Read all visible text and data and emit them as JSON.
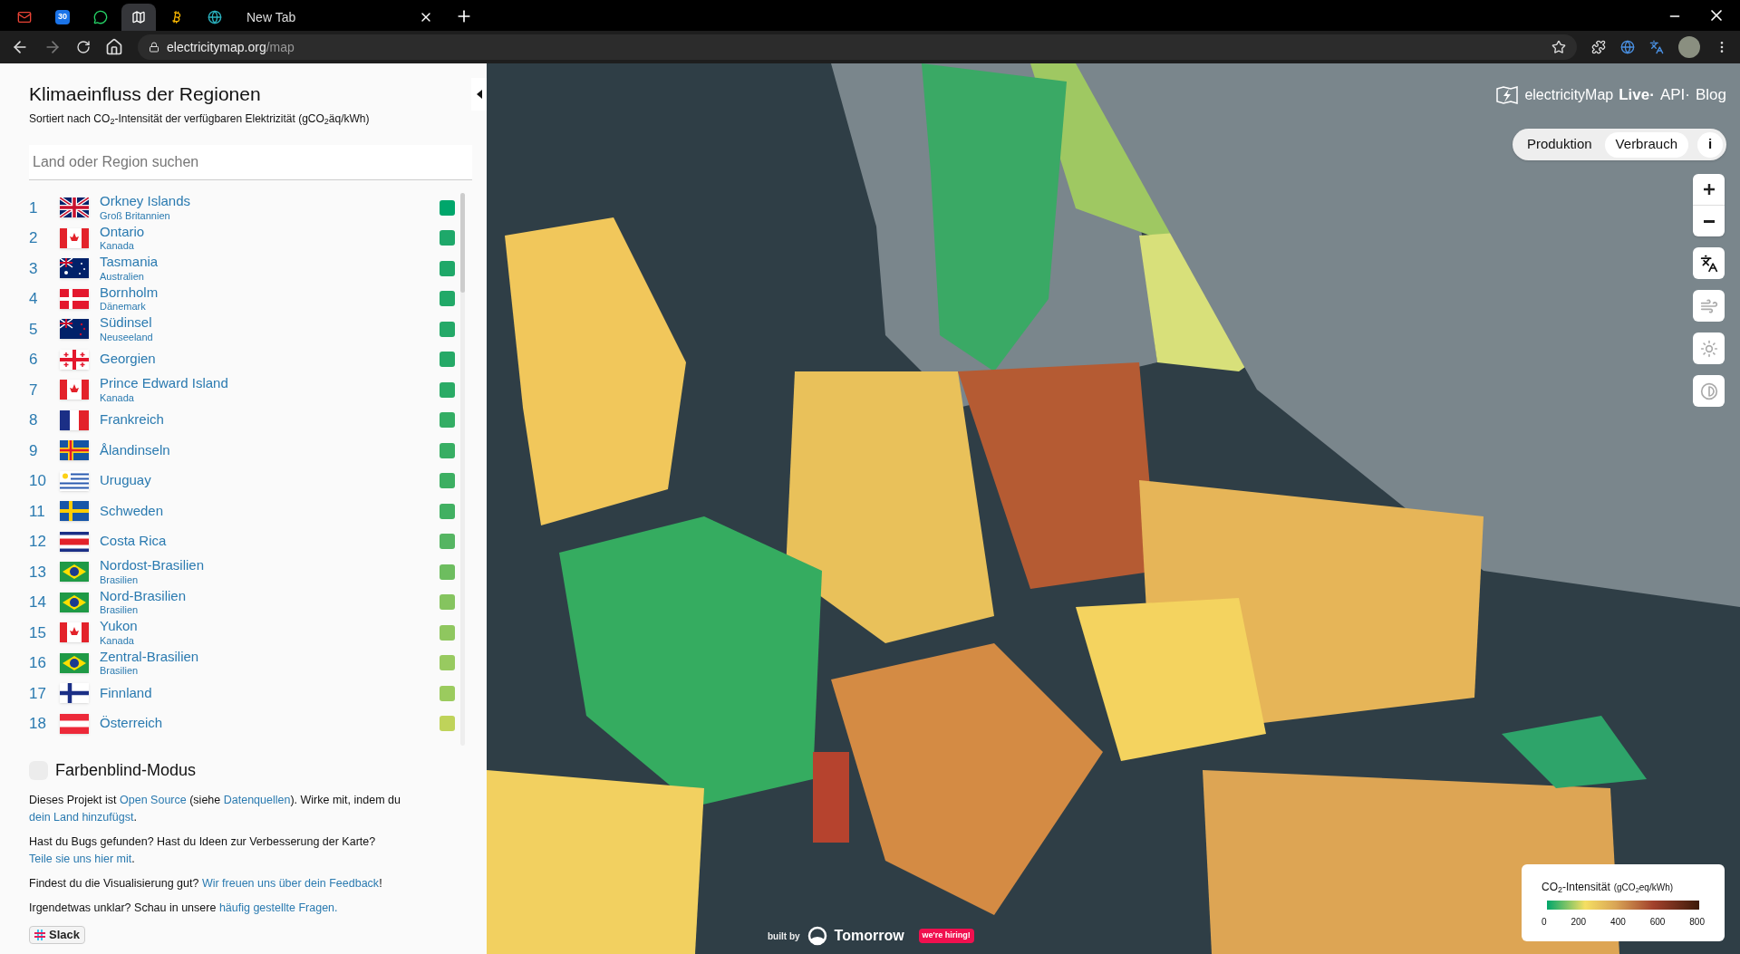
{
  "browser": {
    "tabs": [
      {
        "kind": "mail",
        "selected": false
      },
      {
        "kind": "calendar",
        "label": "30",
        "selected": false
      },
      {
        "kind": "chat",
        "selected": false
      },
      {
        "kind": "map",
        "selected": true
      },
      {
        "kind": "coin",
        "selected": false
      },
      {
        "kind": "globe",
        "selected": false
      },
      {
        "kind": "page",
        "label": "New Tab",
        "selected": false
      }
    ],
    "url_host": "electricitymap.org",
    "url_path": "/map"
  },
  "sidebar": {
    "title": "Klimaeinfluss der Regionen",
    "subtitle": "Sortiert nach CO$_{2}$-Intensität der verfügbaren Elektrizität (gCO$_{2}$äq/kWh)",
    "search": {
      "placeholder": "Land oder Region suchen"
    },
    "regions": [
      {
        "rank": "1",
        "kind": "gb",
        "name": "Orkney Islands",
        "country": "Groß Britannien",
        "color": "#00a66b"
      },
      {
        "rank": "2",
        "kind": "ca",
        "name": "Ontario",
        "country": "Kanada",
        "color": "#1ea86a"
      },
      {
        "rank": "3",
        "kind": "au",
        "name": "Tasmania",
        "country": "Australien",
        "color": "#1fa869"
      },
      {
        "rank": "4",
        "kind": "dk",
        "name": "Bornholm",
        "country": "Dänemark",
        "color": "#22a968"
      },
      {
        "rank": "5",
        "kind": "nz",
        "name": "Südinsel",
        "country": "Neuseeland",
        "color": "#24a968"
      },
      {
        "rank": "6",
        "kind": "ge",
        "name": "Georgien",
        "color": "#25a967"
      },
      {
        "rank": "7",
        "kind": "ca",
        "name": "Prince Edward Island",
        "country": "Kanada",
        "color": "#2aab66"
      },
      {
        "rank": "8",
        "kind": "fr",
        "name": "Frankreich",
        "color": "#33ad64"
      },
      {
        "rank": "9",
        "kind": "ax",
        "name": "Ålandinseln",
        "color": "#37ae63"
      },
      {
        "rank": "10",
        "kind": "uy",
        "name": "Uruguay",
        "color": "#3caf62"
      },
      {
        "rank": "11",
        "kind": "se",
        "name": "Schweden",
        "color": "#41b062"
      },
      {
        "rank": "12",
        "kind": "cr",
        "name": "Costa Rica",
        "color": "#55b562"
      },
      {
        "rank": "13",
        "kind": "br",
        "name": "Nordost-Brasilien",
        "country": "Brasilien",
        "color": "#6dbd5f"
      },
      {
        "rank": "14",
        "kind": "br",
        "name": "Nord-Brasilien",
        "country": "Brasilien",
        "color": "#85c45f"
      },
      {
        "rank": "15",
        "kind": "ca",
        "name": "Yukon",
        "country": "Kanada",
        "color": "#8fc75f"
      },
      {
        "rank": "16",
        "kind": "br",
        "name": "Zentral-Brasilien",
        "country": "Brasilien",
        "color": "#98ca60"
      },
      {
        "rank": "17",
        "kind": "fi",
        "name": "Finnland",
        "color": "#9bcb5e"
      },
      {
        "rank": "18",
        "kind": "at",
        "name": "Österreich",
        "color": "#bfd35a"
      }
    ],
    "colorblind": {
      "label": "Farbenblind-Modus",
      "checked": false
    },
    "paragraphs": [
      [
        {
          "text": "Dieses Projekt ist",
          "link": false
        },
        {
          "text": "Open Source",
          "link": true
        },
        {
          "text": "(siehe",
          "link": false
        },
        {
          "text": "Datenquellen",
          "link": true
        },
        {
          "text": "). Wirke mit, indem du",
          "link": false
        },
        {
          "text": "dein Land hinzufügst",
          "link": true
        },
        {
          "text": ".",
          "link": false
        }
      ],
      [
        {
          "text": "Hast du Bugs gefunden? Hast du Ideen zur Verbesserung der Karte?",
          "link": false
        },
        {
          "text": "Teile sie uns hier mit",
          "link": true
        },
        {
          "text": ".",
          "link": false
        }
      ],
      [
        {
          "text": "Findest du die Visualisierung gut?",
          "link": false
        },
        {
          "text": "Wir freuen uns über dein Feedback",
          "link": true
        },
        {
          "text": "!",
          "link": false
        }
      ],
      [
        {
          "text": "Irgendetwas unklar? Schau in unsere",
          "link": false
        },
        {
          "text": "häufig gestellte Fragen.",
          "link": true
        }
      ]
    ],
    "slack": "Slack"
  },
  "map": {
    "brand": "electricityMap",
    "nav": [
      "Live·",
      "API·",
      "Blog"
    ],
    "modes": [
      {
        "label": "Produktion",
        "selected": false
      },
      {
        "label": "Verbrauch",
        "selected": true
      }
    ],
    "info": "i",
    "layers": [
      {
        "kind": "wind",
        "on": false
      },
      {
        "kind": "solar",
        "on": false
      },
      {
        "kind": "brightness",
        "on": false
      }
    ],
    "legend": {
      "title": "CO$_{2}$-Intensität",
      "unit": "(gCO$_{2}$eq/kWh)",
      "ticks": [
        "0",
        "200",
        "400",
        "600",
        "800"
      ]
    },
    "footer": {
      "built_by": "built by",
      "company": "Tomorrow",
      "hiring": "we're hiring!"
    }
  }
}
